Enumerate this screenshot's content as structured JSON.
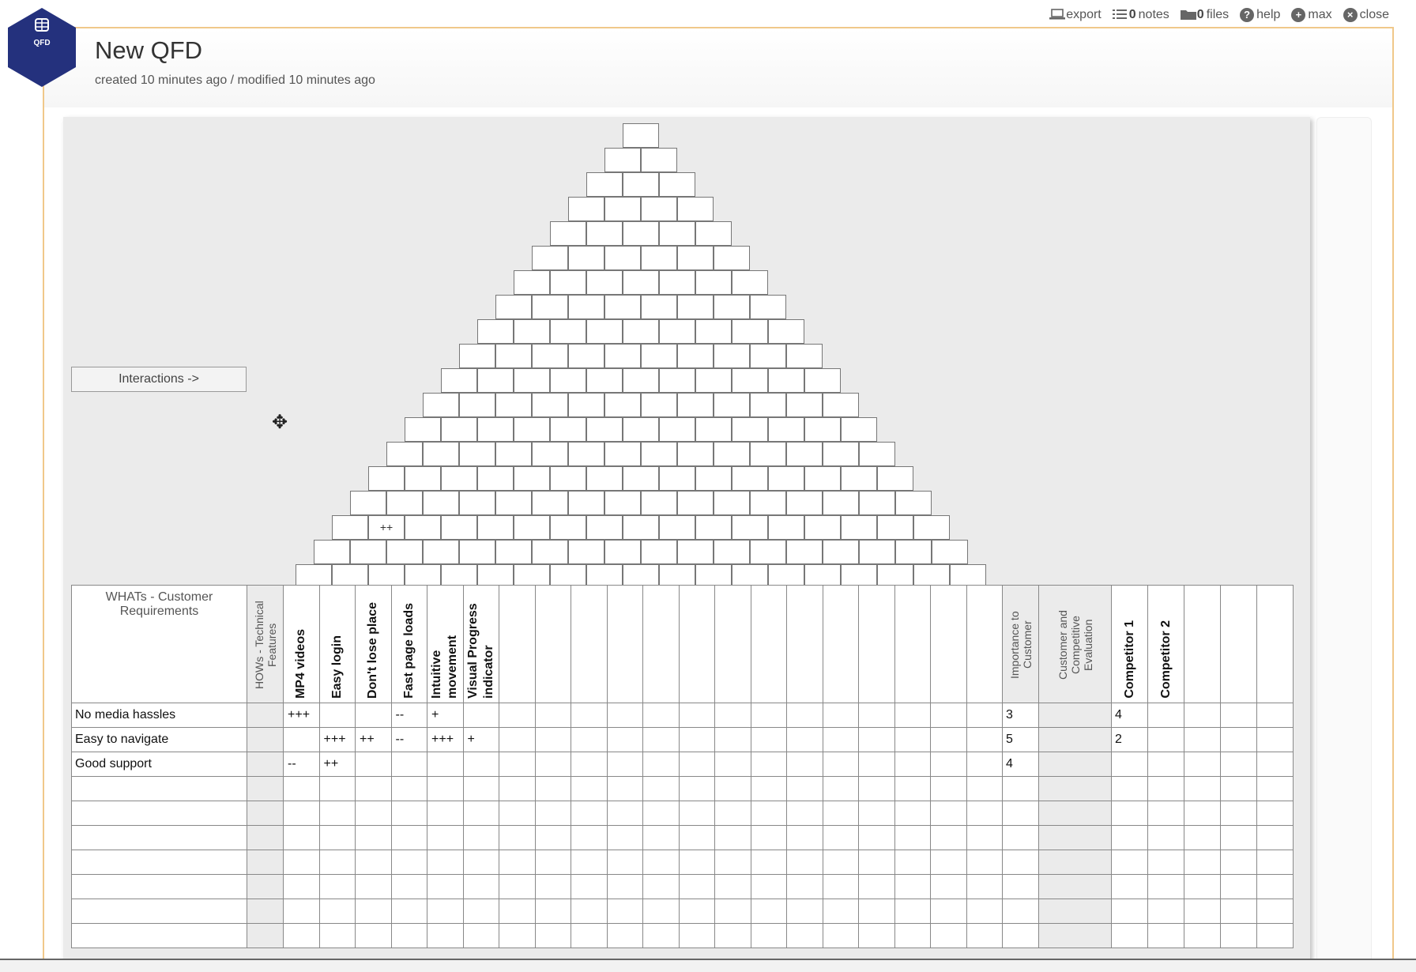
{
  "app": {
    "logo_text": "QFD",
    "title": "New QFD",
    "subtitle": "created 10 minutes ago / modified 10 minutes ago"
  },
  "toolbar": {
    "export_label": "export",
    "notes_count": "0",
    "notes_label": "notes",
    "files_count": "0",
    "files_label": "files",
    "help_label": "help",
    "max_label": "max",
    "close_label": "close"
  },
  "interactions_button": "Interactions ->",
  "triangle": {
    "marks": [
      {
        "row": 16,
        "col": 1,
        "text": "++"
      }
    ]
  },
  "matrix": {
    "whats_header": "WHATs - Customer Requirements",
    "hows_header": "HOWs - Technical Features",
    "features": [
      "MP4 videos",
      "Easy login",
      "Don't lose place",
      "Fast page loads",
      "Intuitive movement",
      "Visual Progress indicator",
      "",
      "",
      "",
      "",
      "",
      "",
      "",
      "",
      "",
      "",
      "",
      "",
      "",
      ""
    ],
    "importance_header": "Importance to Customer",
    "evaluation_header": "Customer and Competitive Evaluation",
    "competitors": [
      "Competitor 1",
      "Competitor 2",
      "",
      "",
      ""
    ],
    "requirements": [
      {
        "label": "No media hassles",
        "rel": [
          "+++",
          "",
          "",
          "--",
          "+",
          "",
          "",
          "",
          "",
          "",
          "",
          "",
          "",
          "",
          "",
          "",
          "",
          "",
          "",
          ""
        ],
        "importance": "3",
        "comp": [
          "4",
          "",
          "",
          "",
          ""
        ]
      },
      {
        "label": "Easy to navigate",
        "rel": [
          "",
          "+++",
          "++",
          "--",
          "+++",
          "+",
          "",
          "",
          "",
          "",
          "",
          "",
          "",
          "",
          "",
          "",
          "",
          "",
          "",
          ""
        ],
        "importance": "5",
        "comp": [
          "2",
          "",
          "",
          "",
          ""
        ]
      },
      {
        "label": "Good support",
        "rel": [
          "--",
          "++",
          "",
          "",
          "",
          "",
          "",
          "",
          "",
          "",
          "",
          "",
          "",
          "",
          "",
          "",
          "",
          "",
          "",
          ""
        ],
        "importance": "4",
        "comp": [
          "",
          "",
          "",
          "",
          ""
        ]
      },
      {
        "label": "",
        "rel": [
          "",
          "",
          "",
          "",
          "",
          "",
          "",
          "",
          "",
          "",
          "",
          "",
          "",
          "",
          "",
          "",
          "",
          "",
          "",
          ""
        ],
        "importance": "",
        "comp": [
          "",
          "",
          "",
          "",
          ""
        ]
      },
      {
        "label": "",
        "rel": [
          "",
          "",
          "",
          "",
          "",
          "",
          "",
          "",
          "",
          "",
          "",
          "",
          "",
          "",
          "",
          "",
          "",
          "",
          "",
          ""
        ],
        "importance": "",
        "comp": [
          "",
          "",
          "",
          "",
          ""
        ]
      },
      {
        "label": "",
        "rel": [
          "",
          "",
          "",
          "",
          "",
          "",
          "",
          "",
          "",
          "",
          "",
          "",
          "",
          "",
          "",
          "",
          "",
          "",
          "",
          ""
        ],
        "importance": "",
        "comp": [
          "",
          "",
          "",
          "",
          ""
        ]
      },
      {
        "label": "",
        "rel": [
          "",
          "",
          "",
          "",
          "",
          "",
          "",
          "",
          "",
          "",
          "",
          "",
          "",
          "",
          "",
          "",
          "",
          "",
          "",
          ""
        ],
        "importance": "",
        "comp": [
          "",
          "",
          "",
          "",
          ""
        ]
      },
      {
        "label": "",
        "rel": [
          "",
          "",
          "",
          "",
          "",
          "",
          "",
          "",
          "",
          "",
          "",
          "",
          "",
          "",
          "",
          "",
          "",
          "",
          "",
          ""
        ],
        "importance": "",
        "comp": [
          "",
          "",
          "",
          "",
          ""
        ]
      },
      {
        "label": "",
        "rel": [
          "",
          "",
          "",
          "",
          "",
          "",
          "",
          "",
          "",
          "",
          "",
          "",
          "",
          "",
          "",
          "",
          "",
          "",
          "",
          ""
        ],
        "importance": "",
        "comp": [
          "",
          "",
          "",
          "",
          ""
        ]
      },
      {
        "label": "",
        "rel": [
          "",
          "",
          "",
          "",
          "",
          "",
          "",
          "",
          "",
          "",
          "",
          "",
          "",
          "",
          "",
          "",
          "",
          "",
          "",
          ""
        ],
        "importance": "",
        "comp": [
          "",
          "",
          "",
          "",
          ""
        ]
      }
    ]
  },
  "colors": {
    "logo": "#24317d",
    "frame": "#f0c88a",
    "canvas": "#ebebeb"
  }
}
